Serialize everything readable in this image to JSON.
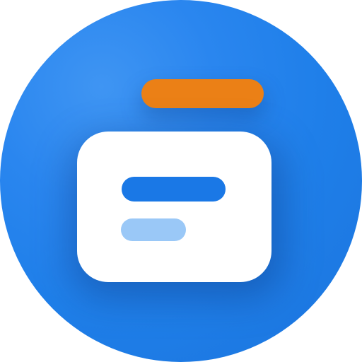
{
  "icon": "document-tray-icon",
  "colors": {
    "background": "#2a86ef",
    "tab": "#eb8016",
    "card": "#ffffff",
    "line_primary": "#1a78e6",
    "line_secondary": "#9ac8f7"
  }
}
